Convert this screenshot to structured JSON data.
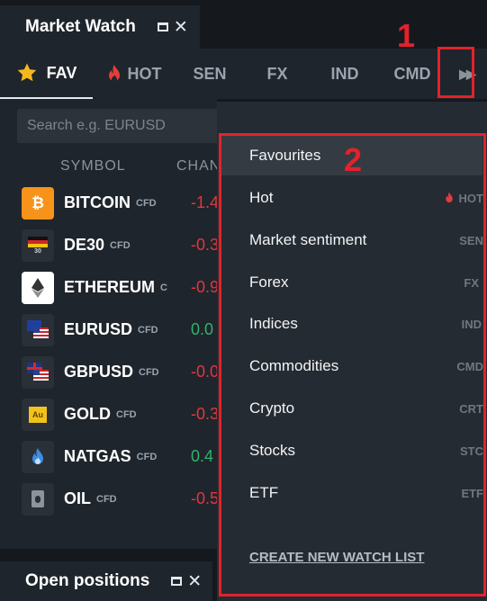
{
  "market_watch": {
    "title": "Market Watch",
    "tabs": [
      {
        "label": "FAV",
        "icon": "star-icon",
        "active": true
      },
      {
        "label": "HOT",
        "icon": "flame-icon"
      },
      {
        "label": "SEN"
      },
      {
        "label": "FX"
      },
      {
        "label": "IND"
      },
      {
        "label": "CMD"
      }
    ],
    "more_tabs_icon": "double-chevron-right-icon",
    "search_placeholder": "Search e.g. EURUSD",
    "columns": {
      "symbol": "SYMBOL",
      "change": "CHAN"
    },
    "rows": [
      {
        "name": "BITCOIN",
        "tag": "CFD",
        "change": "-1.4",
        "trend": "negative",
        "icon": "bitcoin-icon",
        "icon_text": "₿"
      },
      {
        "name": "DE30",
        "tag": "CFD",
        "change": "-0.3",
        "trend": "negative",
        "icon": "germany-flag-icon",
        "icon_text": "30"
      },
      {
        "name": "ETHEREUM",
        "tag": "C",
        "change": "-0.9",
        "trend": "negative",
        "icon": "ethereum-icon",
        "icon_text": ""
      },
      {
        "name": "EURUSD",
        "tag": "CFD",
        "change": "0.0",
        "trend": "positive",
        "icon": "eu-us-flags-icon",
        "icon_text": ""
      },
      {
        "name": "GBPUSD",
        "tag": "CFD",
        "change": "-0.0",
        "trend": "negative",
        "icon": "uk-us-flags-icon",
        "icon_text": ""
      },
      {
        "name": "GOLD",
        "tag": "CFD",
        "change": "-0.3",
        "trend": "negative",
        "icon": "gold-icon",
        "icon_text": "Au"
      },
      {
        "name": "NATGAS",
        "tag": "CFD",
        "change": "0.4",
        "trend": "positive",
        "icon": "gas-flame-icon",
        "icon_text": ""
      },
      {
        "name": "OIL",
        "tag": "CFD",
        "change": "-0.5",
        "trend": "negative",
        "icon": "oil-barrel-icon",
        "icon_text": ""
      }
    ]
  },
  "open_positions": {
    "title": "Open positions"
  },
  "dropdown": {
    "items": [
      {
        "label": "Favourites",
        "abbr": "",
        "highlighted": true
      },
      {
        "label": "Hot",
        "abbr": "HOT",
        "icon": "flame-icon"
      },
      {
        "label": "Market sentiment",
        "abbr": "SEN"
      },
      {
        "label": "Forex",
        "abbr": "FX"
      },
      {
        "label": "Indices",
        "abbr": "IND"
      },
      {
        "label": "Commodities",
        "abbr": "CMD"
      },
      {
        "label": "Crypto",
        "abbr": "CRT"
      },
      {
        "label": "Stocks",
        "abbr": "STC"
      },
      {
        "label": "ETF",
        "abbr": "ETF"
      }
    ],
    "create_link": "CREATE NEW WATCH LIST"
  },
  "annotations": {
    "marker_1": "1",
    "marker_2": "2",
    "color": "#e3222b"
  }
}
